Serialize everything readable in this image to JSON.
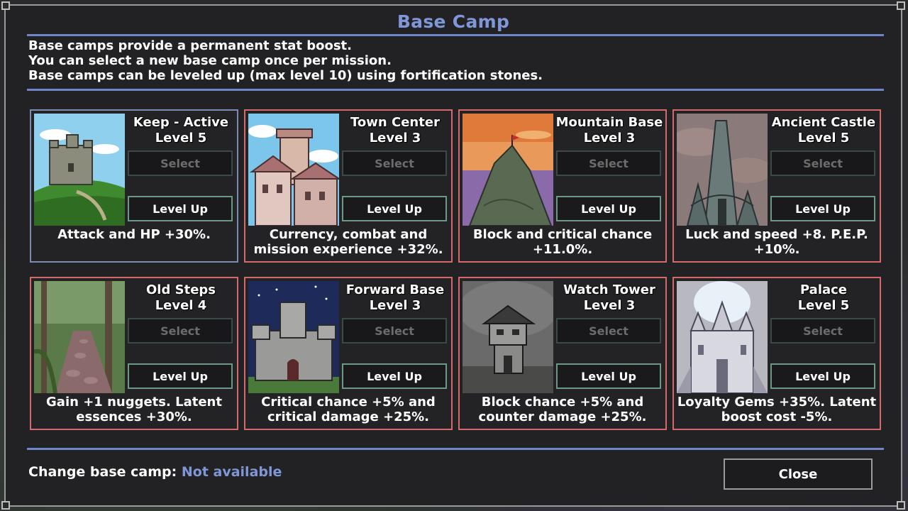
{
  "dialog": {
    "title": "Base Camp",
    "description": [
      "Base camps provide a permanent stat boost.",
      "You can select a new base camp once per mission.",
      "Base camps can be leveled up (max level 10) using fortification stones."
    ]
  },
  "camps": [
    {
      "name": "Keep - Active",
      "level": "Level 5",
      "select_label": "Select",
      "levelup_label": "Level Up",
      "effect": [
        "Attack and HP +30%.",
        ""
      ],
      "active": true,
      "icon": "keep-image"
    },
    {
      "name": "Town Center",
      "level": "Level 3",
      "select_label": "Select",
      "levelup_label": "Level Up",
      "effect": [
        "Currency, combat and",
        "mission experience +32%."
      ],
      "active": false,
      "icon": "town-center-image"
    },
    {
      "name": "Mountain Base",
      "level": "Level 3",
      "select_label": "Select",
      "levelup_label": "Level Up",
      "effect": [
        "Block and critical chance",
        "+11.0%."
      ],
      "active": false,
      "icon": "mountain-base-image"
    },
    {
      "name": "Ancient Castle",
      "level": "Level 5",
      "select_label": "Select",
      "levelup_label": "Level Up",
      "effect": [
        "Luck and speed +8. P.E.P.",
        "+10%."
      ],
      "active": false,
      "icon": "ancient-castle-image"
    },
    {
      "name": "Old Steps",
      "level": "Level 4",
      "select_label": "Select",
      "levelup_label": "Level Up",
      "effect": [
        "Gain +1 nuggets. Latent",
        "essences +30%."
      ],
      "active": false,
      "icon": "old-steps-image"
    },
    {
      "name": "Forward Base",
      "level": "Level 3",
      "select_label": "Select",
      "levelup_label": "Level Up",
      "effect": [
        "Critical chance +5% and",
        "critical damage +25%."
      ],
      "active": false,
      "icon": "forward-base-image"
    },
    {
      "name": "Watch Tower",
      "level": "Level 3",
      "select_label": "Select",
      "levelup_label": "Level Up",
      "effect": [
        "Block chance +5% and",
        "counter damage +25%."
      ],
      "active": false,
      "icon": "watch-tower-image"
    },
    {
      "name": "Palace",
      "level": "Level 5",
      "select_label": "Select",
      "levelup_label": "Level Up",
      "effect": [
        "Loyalty Gems +35%. Latent",
        "boost cost -5%."
      ],
      "active": false,
      "icon": "palace-image"
    }
  ],
  "footer": {
    "change_label": "Change base camp:",
    "change_value": "Not available",
    "close_label": "Close"
  },
  "colors": {
    "accent": "#7f97d8",
    "card_border": "#d46a6a",
    "active_border": "#7d8ab3",
    "levelup_border": "#6a9a86"
  }
}
